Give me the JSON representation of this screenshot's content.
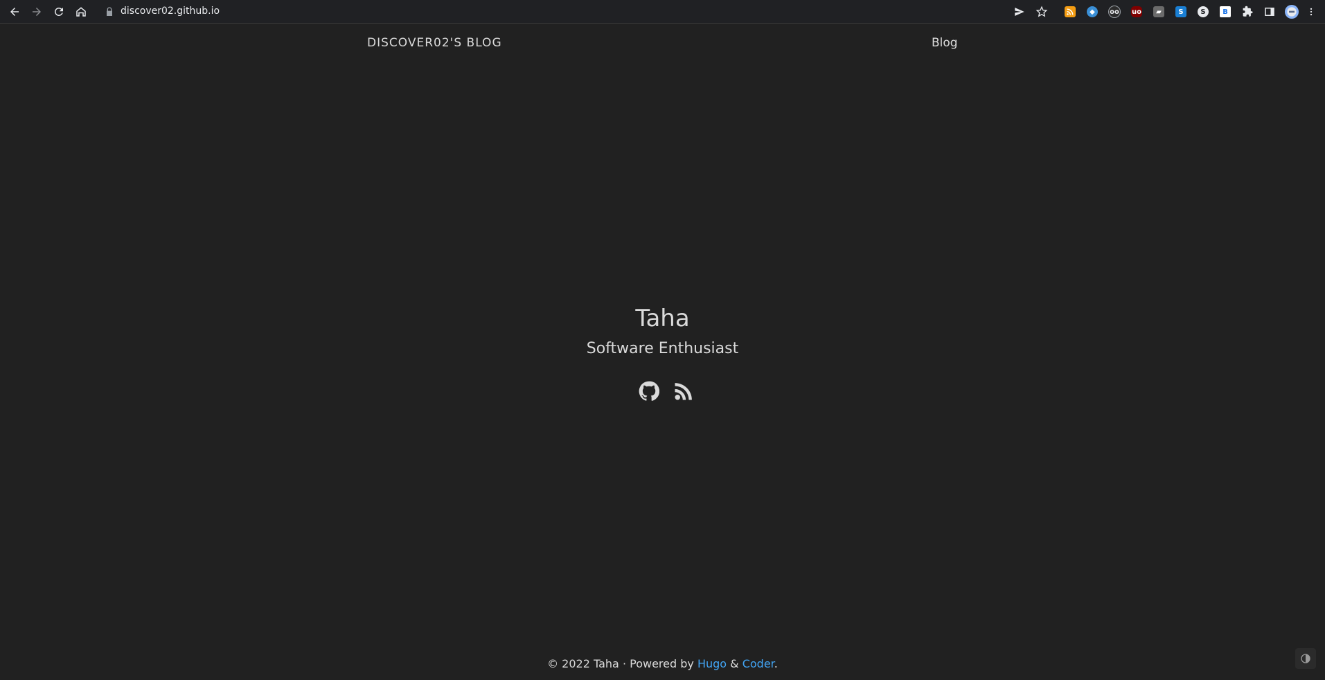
{
  "browser": {
    "url": "discover02.github.io",
    "icons": {
      "back": "arrow-left-icon",
      "forward": "arrow-right-icon",
      "reload": "reload-icon",
      "home": "home-icon",
      "lock": "lock-icon",
      "send": "send-icon",
      "bookmark": "star-icon",
      "extensions": "puzzle-icon",
      "sidepanel": "side-panel-icon",
      "menu": "kebab-menu-icon"
    }
  },
  "header": {
    "site_title": "DISCOVER02'S BLOG",
    "nav": [
      {
        "label": "Blog"
      }
    ]
  },
  "profile": {
    "name": "Taha",
    "tagline": "Software Enthusiast",
    "social_icons": [
      "github-icon",
      "rss-icon"
    ]
  },
  "footer": {
    "prefix": "© 2022 Taha · Powered by ",
    "hugo": "Hugo",
    "amp": " & ",
    "coder": "Coder",
    "suffix": "."
  },
  "colors": {
    "background": "#212121",
    "text": "#dadada",
    "link": "#42a5f5",
    "chrome": "#202124"
  }
}
